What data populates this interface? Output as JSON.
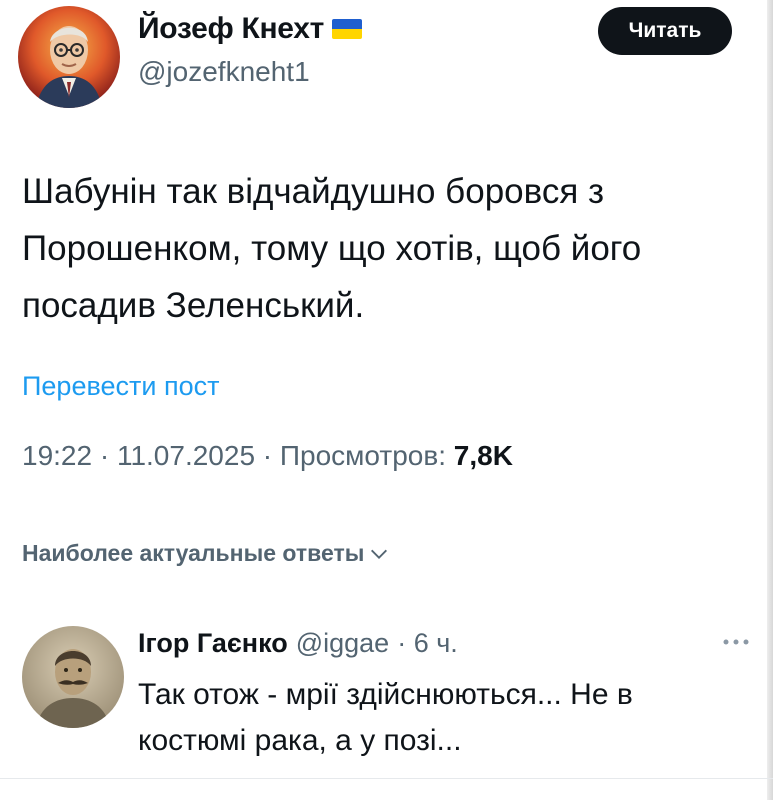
{
  "post": {
    "author_name": "Йозеф Кнехт",
    "author_handle": "@jozefkneht1",
    "follow_label": "Читать",
    "text_lines": [
      "Шабунін так відчайдушно боровся з",
      "Порошенком, тому що хотів, щоб його",
      "посадив Зеленський."
    ],
    "translate_label": "Перевести пост",
    "timestamp": "19:22 · 11.07.2025 · Просмотров: ",
    "views": "7,8K"
  },
  "replies_sort": {
    "label": "Наиболее актуальные ответы"
  },
  "reply": {
    "author_name": "Ігор Гаєнко",
    "author_handle": "@iggae",
    "time": "· 6 ч.",
    "text_lines": [
      "Так отож - мрії здійснюються... Не в",
      "костюмі рака, а у позі..."
    ]
  },
  "icons": {
    "flag": "ukraine-flag-icon",
    "chevron": "chevron-down-icon",
    "more": "more-options-icon"
  },
  "colors": {
    "accent": "#1d9bf0",
    "text": "#0f1419",
    "muted": "#536471",
    "button_bg": "#0f1419",
    "flag_blue": "#1f5fcf",
    "flag_yellow": "#ffd500"
  }
}
